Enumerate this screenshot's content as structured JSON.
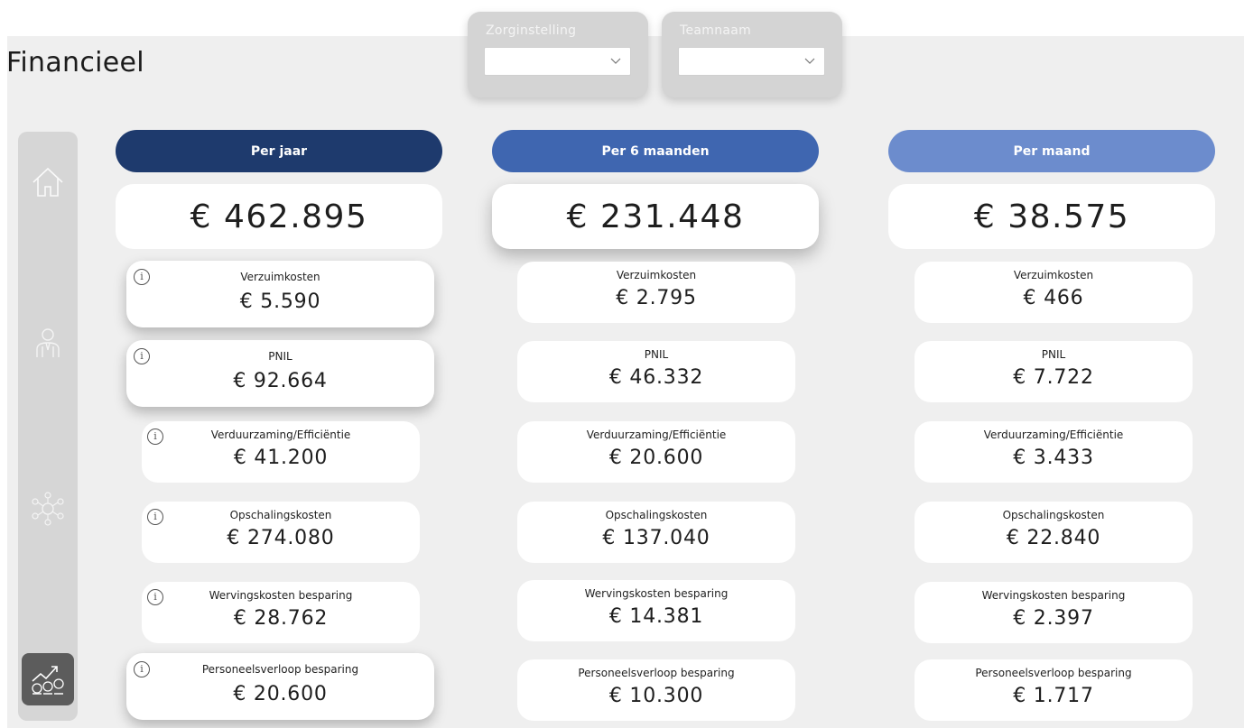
{
  "page": {
    "title": "Financieel"
  },
  "slicers": [
    {
      "label": "Zorginstelling",
      "value": ""
    },
    {
      "label": "Teamnaam",
      "value": ""
    }
  ],
  "sidebar": {
    "items": [
      {
        "icon": "home-icon"
      },
      {
        "icon": "person-icon"
      },
      {
        "icon": "network-icon"
      },
      {
        "icon": "finance-chart-icon",
        "active": true
      }
    ]
  },
  "colors": {
    "per_jaar": "#1e3a6d",
    "per_6_maanden": "#3f66b0",
    "per_maand": "#6c8ccd"
  },
  "columns": [
    {
      "header": "Per jaar",
      "total": "€ 462.895",
      "items": [
        {
          "label": "Verzuimkosten",
          "value": "€ 5.590"
        },
        {
          "label": "PNIL",
          "value": "€ 92.664"
        },
        {
          "label": "Verduurzaming/Efficiëntie",
          "value": "€ 41.200"
        },
        {
          "label": "Opschalingskosten",
          "value": "€ 274.080"
        },
        {
          "label": "Wervingskosten besparing",
          "value": "€ 28.762"
        },
        {
          "label": "Personeelsverloop besparing",
          "value": "€ 20.600"
        }
      ]
    },
    {
      "header": "Per 6 maanden",
      "total": "€ 231.448",
      "items": [
        {
          "label": "Verzuimkosten",
          "value": "€ 2.795"
        },
        {
          "label": "PNIL",
          "value": "€ 46.332"
        },
        {
          "label": "Verduurzaming/Efficiëntie",
          "value": "€ 20.600"
        },
        {
          "label": "Opschalingskosten",
          "value": "€ 137.040"
        },
        {
          "label": "Wervingskosten besparing",
          "value": "€ 14.381"
        },
        {
          "label": "Personeelsverloop besparing",
          "value": "€ 10.300"
        }
      ]
    },
    {
      "header": "Per maand",
      "total": "€ 38.575",
      "items": [
        {
          "label": "Verzuimkosten",
          "value": "€ 466"
        },
        {
          "label": "PNIL",
          "value": "€ 7.722"
        },
        {
          "label": "Verduurzaming/Efficiëntie",
          "value": "€ 3.433"
        },
        {
          "label": "Opschalingskosten",
          "value": "€ 22.840"
        },
        {
          "label": "Wervingskosten besparing",
          "value": "€ 2.397"
        },
        {
          "label": "Personeelsverloop besparing",
          "value": "€ 1.717"
        }
      ]
    }
  ],
  "info_icon": {
    "glyph": "i"
  }
}
